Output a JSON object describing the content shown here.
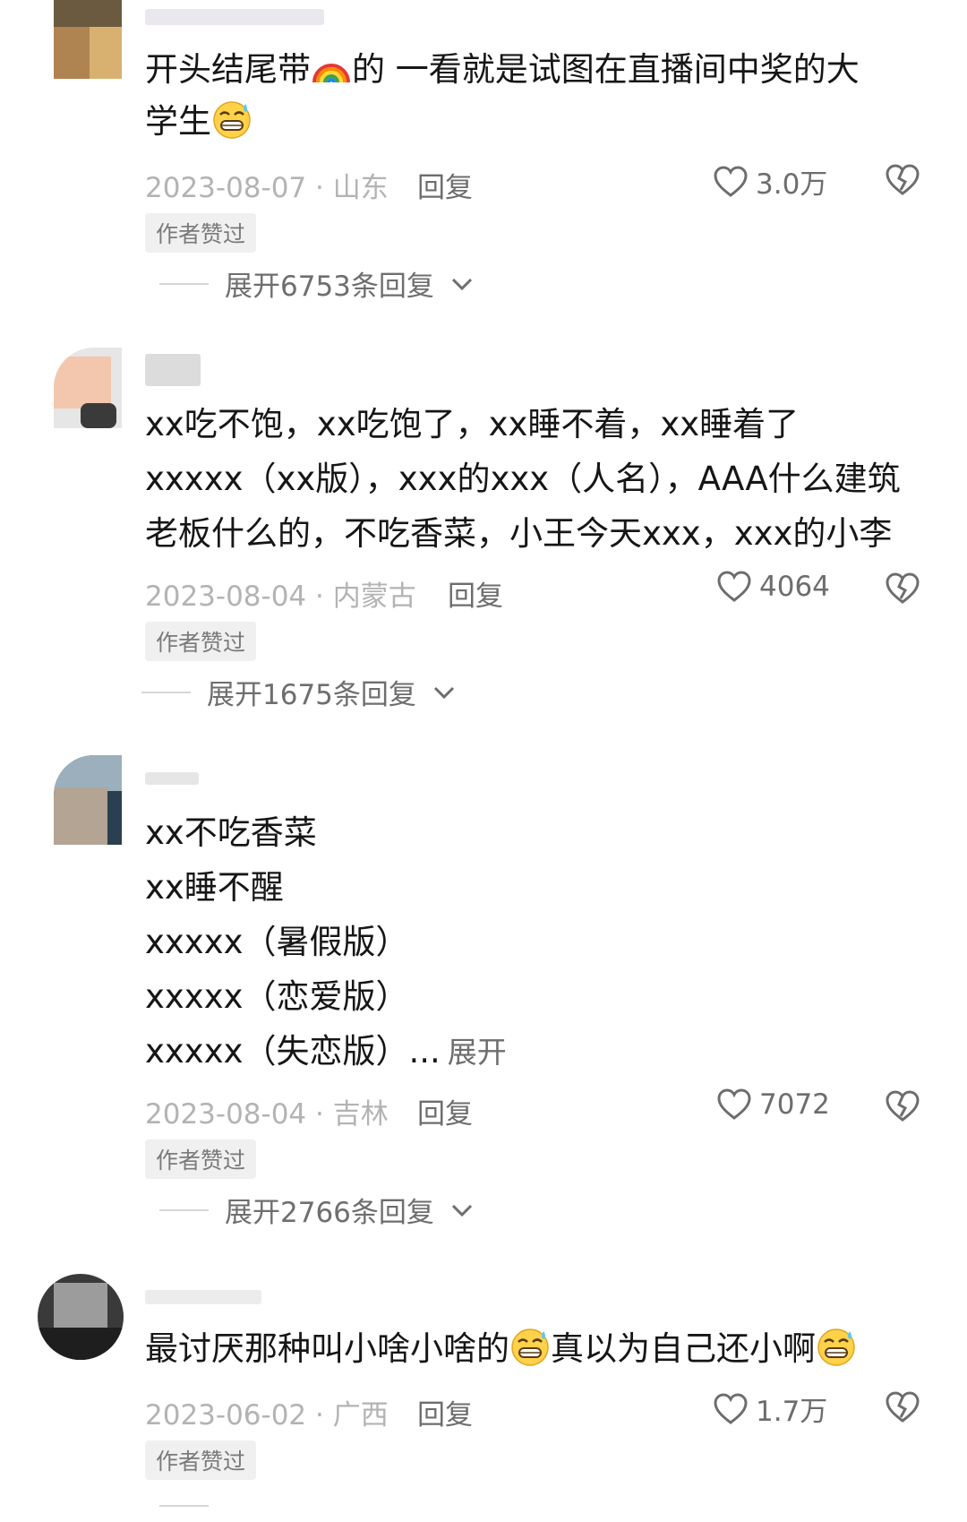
{
  "comments": [
    {
      "text_lines": [
        "开头结尾带",
        "学生"
      ],
      "line1_rest": "的 一看就是试图在直播间中奖的大",
      "date": "2023-08-07 · 山东",
      "reply": "回复",
      "likes": "3.0万",
      "badge": "作者赞过",
      "expand_replies": "展开6753条回复"
    },
    {
      "text_lines": [
        "xx吃不饱，xx吃饱了，xx睡不着，xx睡着了",
        "xxxxx（xx版），xxx的xxx（人名），AAA什么建筑",
        "老板什么的，不吃香菜，小王今天xxx，xxx的小李"
      ],
      "date": "2023-08-04 · 内蒙古",
      "reply": "回复",
      "likes": "4064",
      "badge": "作者赞过",
      "expand_replies": "展开1675条回复"
    },
    {
      "text_lines": [
        "xx不吃香菜",
        "xx睡不醒",
        "xxxxx（暑假版）",
        "xxxxx（恋爱版）",
        "xxxxx（失恋版）..."
      ],
      "expand_text": "展开",
      "date": "2023-08-04 · 吉林",
      "reply": "回复",
      "likes": "7072",
      "badge": "作者赞过",
      "expand_replies": "展开2766条回复"
    },
    {
      "text_part1": "最讨厌那种叫小啥小啥的",
      "text_part2": "真以为自己还小啊",
      "date": "2023-06-02 · 广西",
      "reply": "回复",
      "likes": "1.7万",
      "badge": "作者赞过"
    }
  ],
  "colors": {
    "text": "#161616",
    "meta": "#b3b3b3",
    "secondary": "#6e6e6e",
    "badge_bg": "#f0f0f0"
  }
}
